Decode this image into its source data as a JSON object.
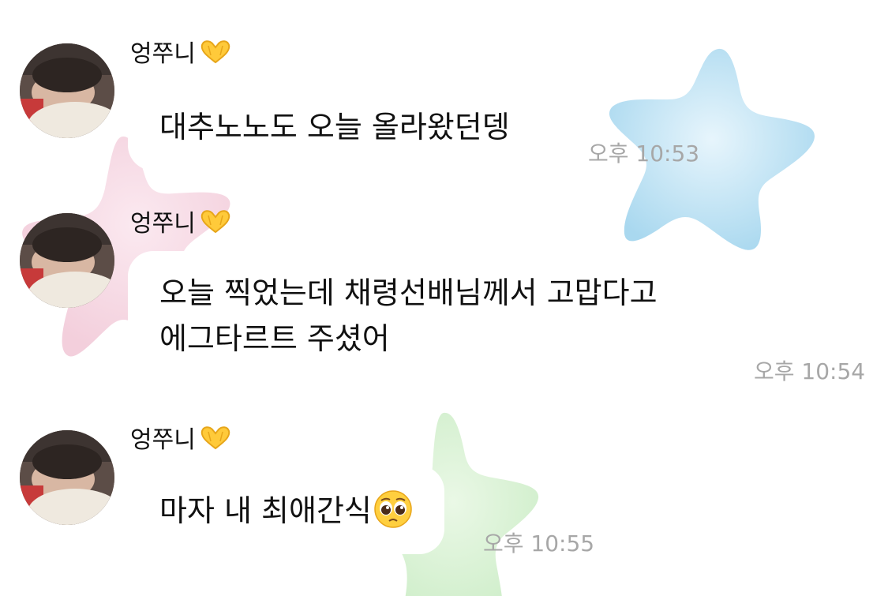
{
  "colors": {
    "background": "#ffffff",
    "bubble": "#ffffff",
    "text": "#111111",
    "timestamp": "#a7a7a7",
    "star_blue": "#a9d8ef",
    "star_pink": "#f3cfdc",
    "star_green": "#cfeeca"
  },
  "decorations": [
    {
      "name": "star-blue-icon",
      "color": "#a9d8ef"
    },
    {
      "name": "star-pink-icon",
      "color": "#f3cfdc"
    },
    {
      "name": "star-green-icon",
      "color": "#cfeeca"
    }
  ],
  "messages": [
    {
      "sender": "엉쭈니",
      "sender_emoji": "heart-hands-icon",
      "lines": [
        "대추노노도 오늘 올라왔던뎅"
      ],
      "time": "오후 10:53"
    },
    {
      "sender": "엉쭈니",
      "sender_emoji": "heart-hands-icon",
      "lines": [
        "오늘 찍었는데 채령선배님께서 고맙다고",
        "에그타르트 주셨어"
      ],
      "time": "오후 10:54"
    },
    {
      "sender": "엉쭈니",
      "sender_emoji": "heart-hands-icon",
      "lines": [
        "마자 내 최애간식"
      ],
      "trailing_emoji": "pleading-face-icon",
      "time": "오후 10:55"
    }
  ]
}
